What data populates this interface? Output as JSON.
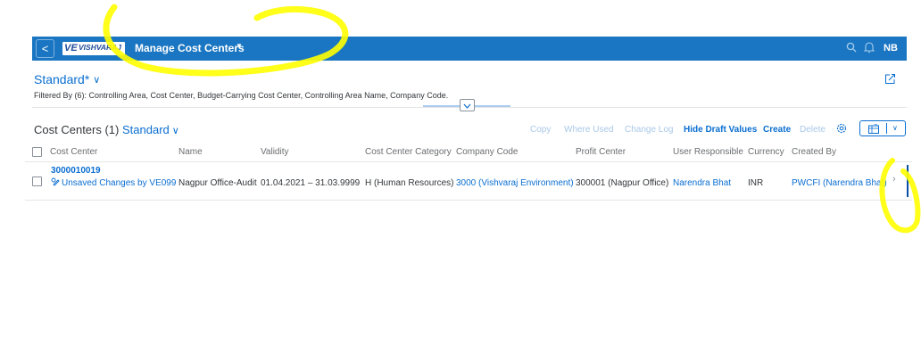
{
  "shell": {
    "back_glyph": "<",
    "logo_mark": "VE",
    "logo_text": "VISHVARAJ",
    "app_title": "Manage Cost Centers",
    "avatar_initials": "NB",
    "color": "#1a76c2"
  },
  "header": {
    "variant": "Standard*",
    "filtered_by": "Filtered By (6): Controlling Area, Cost Center, Budget-Carrying Cost Center, Controlling Area Name, Company Code."
  },
  "table": {
    "title_prefix": "Cost Centers (1)",
    "title_variant": "Standard",
    "toolbar": {
      "copy": "Copy",
      "where_used": "Where Used",
      "change_log": "Change Log",
      "hide_draft": "Hide Draft Values",
      "create": "Create",
      "delete": "Delete"
    },
    "columns": {
      "cost_center": "Cost Center",
      "name": "Name",
      "validity": "Validity",
      "category": "Cost Center Category",
      "company_code": "Company Code",
      "profit_center": "Profit Center",
      "user_responsible": "User Responsible",
      "currency": "Currency",
      "created_by": "Created By"
    },
    "rows": [
      {
        "cost_center": "3000010019",
        "draft_note": "Unsaved Changes by VE099",
        "name": "Nagpur Office-Audit",
        "validity": "01.04.2021 – 31.03.9999",
        "category": "H (Human Resources)",
        "company_code": "3000 (Vishvaraj Environment)",
        "profit_center": "300001 (Nagpur Office)",
        "user_responsible": "Narendra Bhat",
        "currency": "INR",
        "created_by": "PWCFI (Narendra Bhat)"
      }
    ]
  },
  "colors": {
    "link": "#0a6ed1",
    "annotation": "#ffff00"
  }
}
